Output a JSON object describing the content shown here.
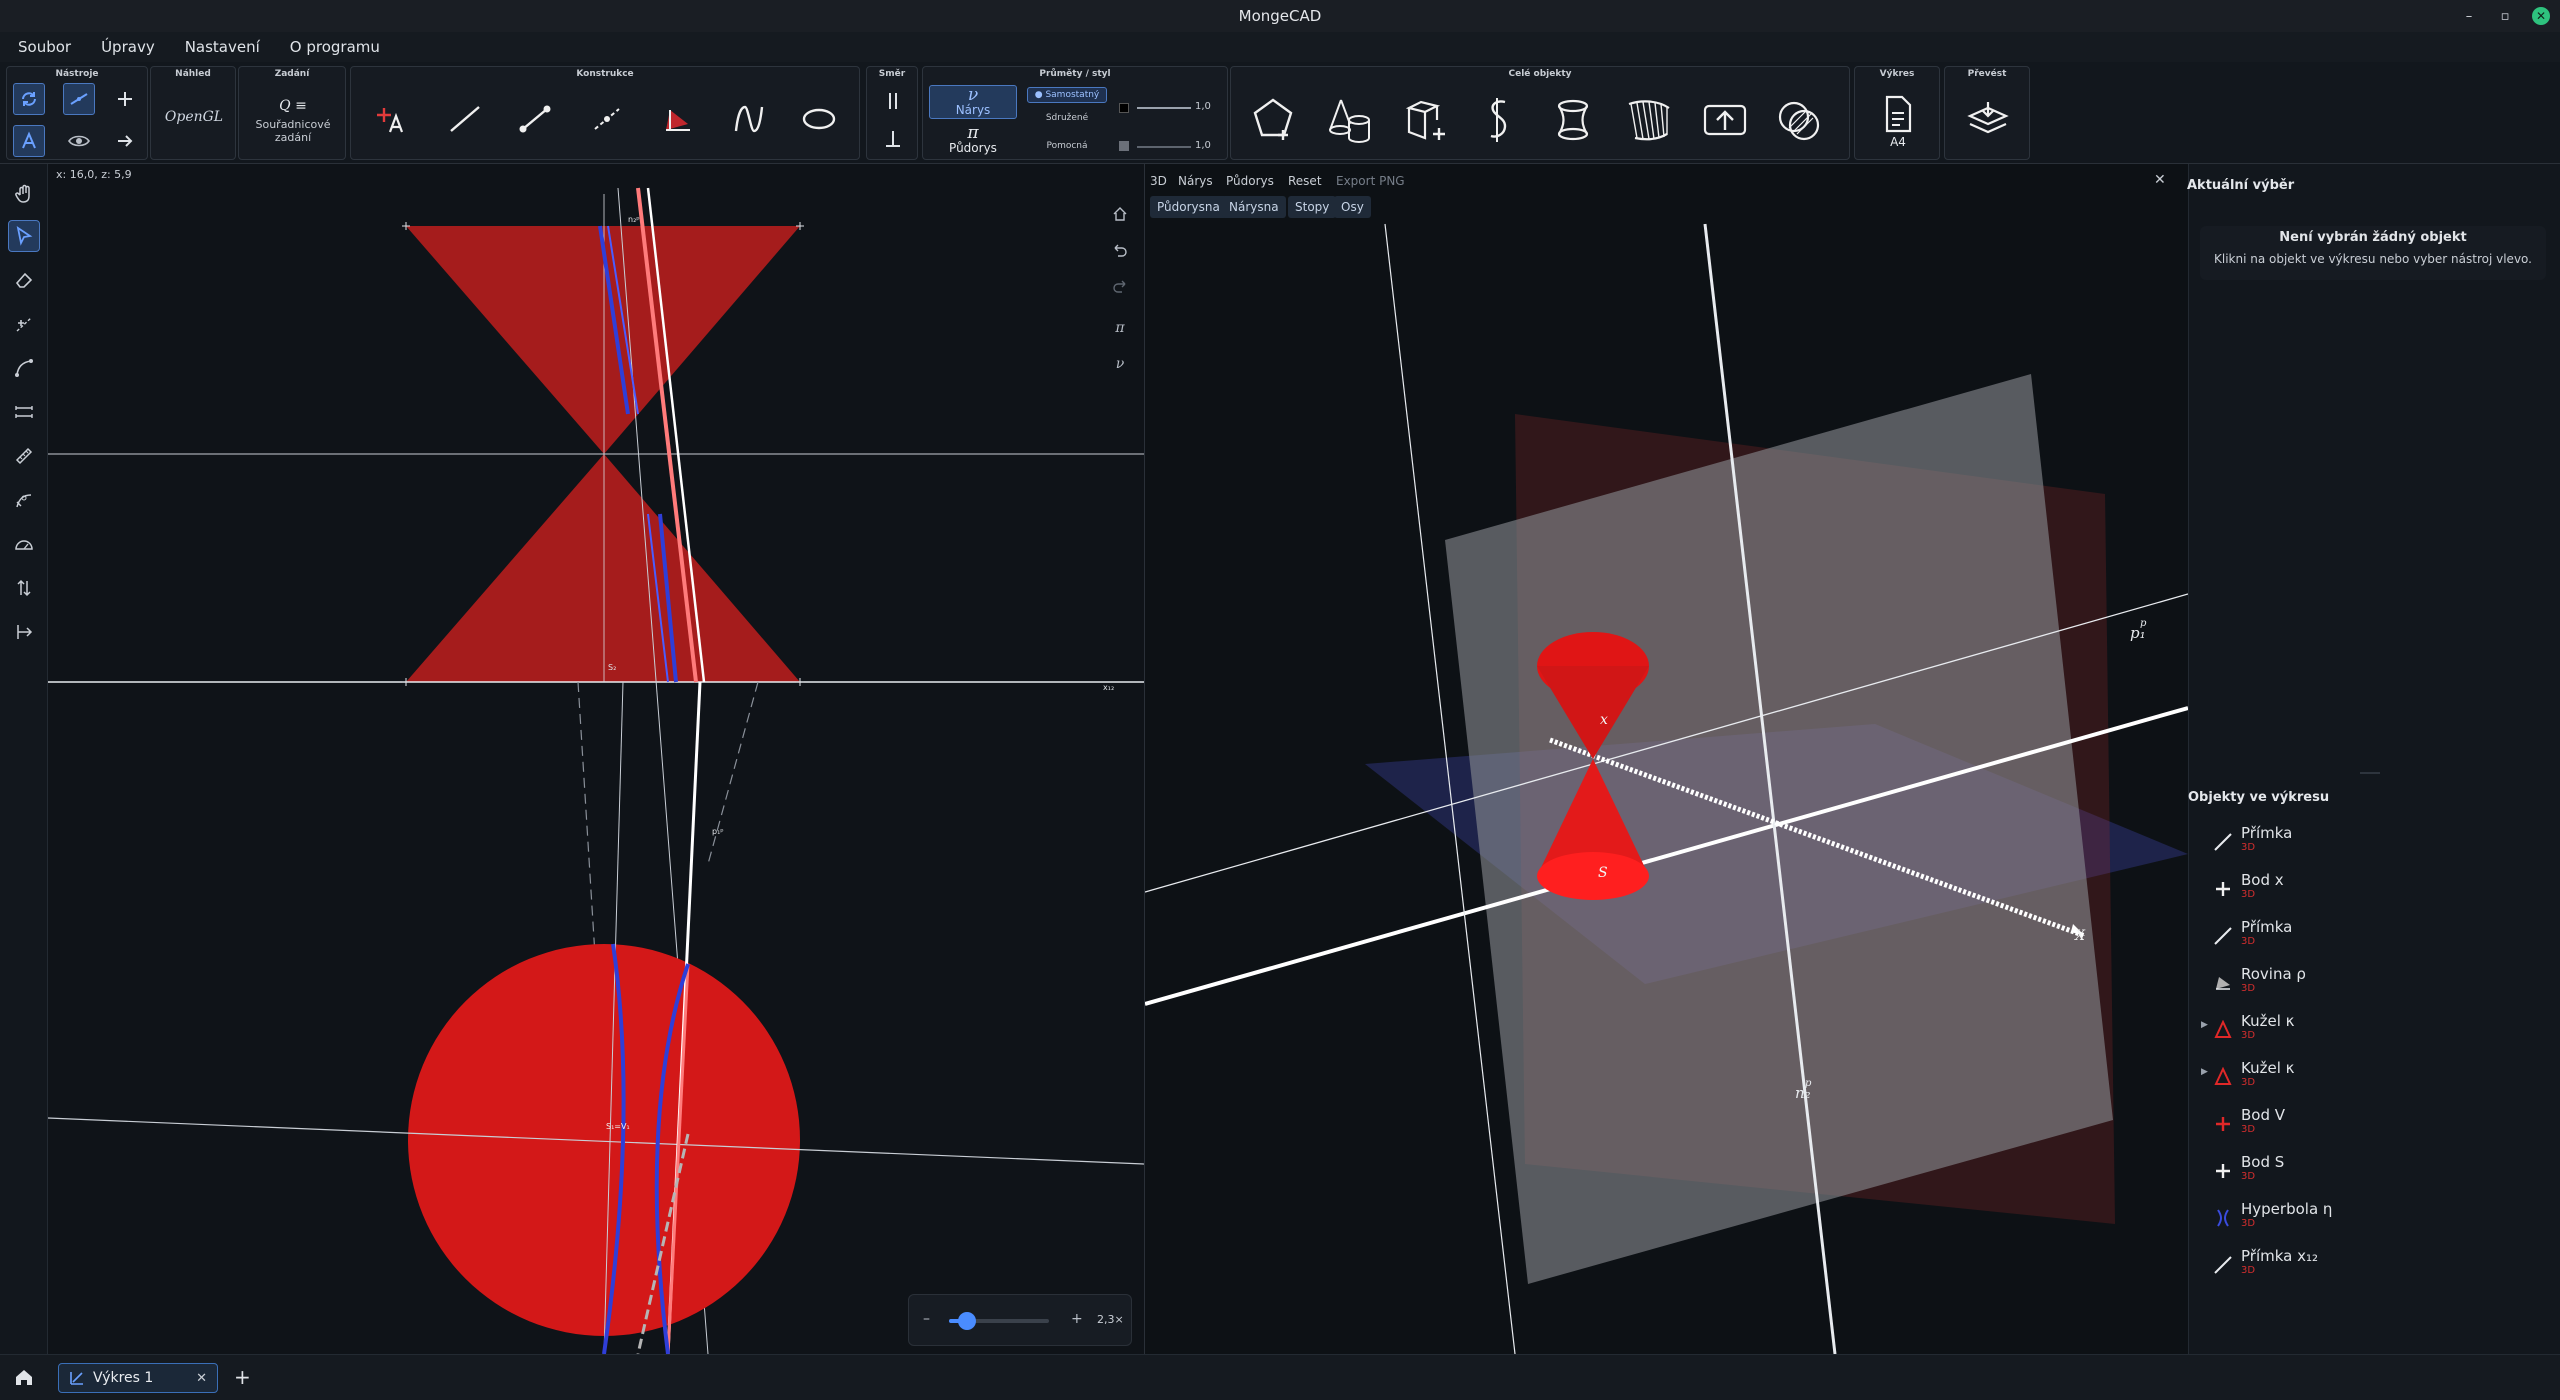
{
  "window": {
    "title": "MongeCAD"
  },
  "menu": [
    "Soubor",
    "Úpravy",
    "Nastavení",
    "O programu"
  ],
  "ribbon": {
    "groups": {
      "tools": "Nástroje",
      "preview": "Náhled",
      "input": "Zadání",
      "construction": "Konstrukce",
      "direction": "Směr",
      "projections": "Průměty / styl",
      "solids": "Celé objekty",
      "drawing": "Výkres",
      "convert": "Převést"
    },
    "preview_label": "OpenGL",
    "input_label": "Souřadnicové zadání",
    "input_formula": "Q ≡",
    "projection_nu_symbol": "ν",
    "projection_nu_label": "Nárys",
    "projection_pi_symbol": "π",
    "projection_pi_label": "Půdorys",
    "style_options": [
      "Samostatný",
      "Sdružené",
      "Pomocná"
    ],
    "style_value_1": "1,0",
    "style_value_2": "1,0",
    "paper_label": "A4"
  },
  "canvas2d": {
    "coords": "x: 16,0, z: 5,9",
    "zoom_minus": "–",
    "zoom_plus": "+",
    "zoom_value": "2,3×",
    "zoom_level": 0.18,
    "nav_pi": "π",
    "nav_nu": "ν"
  },
  "view3d": {
    "tabs": [
      "3D",
      "Nárys",
      "Půdorys",
      "Reset",
      "Export PNG"
    ],
    "chips": [
      "Půdorysna",
      "Nárysna",
      "Stopy",
      "Osy"
    ],
    "labels": {
      "p1": "p₁",
      "p_sup": "p",
      "n2": "n₂",
      "n_sup": "p",
      "x": "x",
      "X": "X",
      "S": "S"
    }
  },
  "selection": {
    "title": "Aktuální výběr",
    "none": "Není vybrán žádný objekt",
    "hint": "Klikni na objekt ve výkresu nebo vyber nástroj vlevo."
  },
  "objects": {
    "title": "Objekty ve výkresu",
    "items": [
      {
        "name": "Přímka",
        "sub": "3D",
        "icon": "line-icon",
        "expandable": false
      },
      {
        "name": "Bod x",
        "sub": "3D",
        "icon": "point-icon",
        "expandable": false
      },
      {
        "name": "Přímka",
        "sub": "3D",
        "icon": "line-icon",
        "expandable": false
      },
      {
        "name": "Rovina ρ",
        "sub": "3D",
        "icon": "plane-icon",
        "expandable": false
      },
      {
        "name": "Kužel κ",
        "sub": "3D",
        "icon": "cone-icon",
        "expandable": true
      },
      {
        "name": "Kužel κ",
        "sub": "3D",
        "icon": "cone-icon",
        "expandable": true
      },
      {
        "name": "Bod V",
        "sub": "3D",
        "icon": "point-red-icon",
        "expandable": false
      },
      {
        "name": "Bod S",
        "sub": "3D",
        "icon": "point-icon",
        "expandable": false
      },
      {
        "name": "Hyperbola η",
        "sub": "3D",
        "icon": "hyperbola-icon",
        "expandable": false
      },
      {
        "name": "Přímka x₁₂",
        "sub": "3D",
        "icon": "line-icon",
        "expandable": false
      }
    ]
  },
  "tabs": {
    "document": "Výkres 1"
  }
}
